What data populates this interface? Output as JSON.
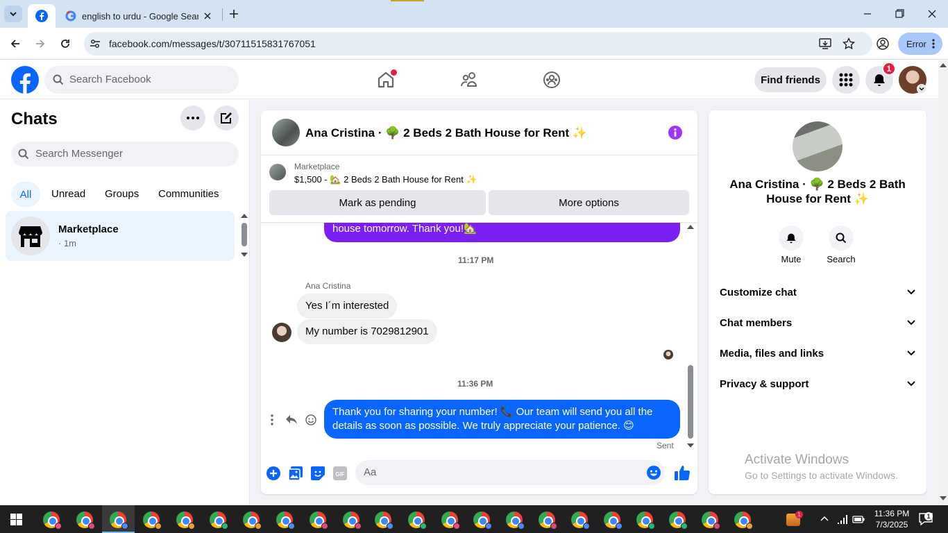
{
  "browser": {
    "tabs": [
      {
        "label": "",
        "icon": "facebook-icon"
      },
      {
        "label": "english to urdu - Google Search",
        "icon": "google-icon"
      }
    ],
    "url": "facebook.com/messages/t/30711515831767051",
    "profile_button": "Error"
  },
  "fb_header": {
    "search_placeholder": "Search Facebook",
    "find_friends": "Find friends",
    "notification_count": "1"
  },
  "left_panel": {
    "title": "Chats",
    "search_placeholder": "Search Messenger",
    "filters": [
      "All",
      "Unread",
      "Groups",
      "Communities"
    ],
    "chat": {
      "name": "Marketplace",
      "meta": "· 1m"
    }
  },
  "conversation": {
    "title": "Ana Cristina · 🌳 2 Beds 2 Bath House for Rent ✨",
    "listing_label": "Marketplace",
    "listing_text": "$1,500 - 🏡 2 Beds 2 Bath House for Rent ✨",
    "mark_pending": "Mark as pending",
    "more_options": "More options",
    "partial_msg": "house tomorrow. Thank you!🏡",
    "time1": "11:17 PM",
    "sender": "Ana Cristina",
    "msg1": "Yes I´m interested",
    "msg2": "My number is 7029812901",
    "time2": "11:36 PM",
    "msg3_line1": "Thank you for sharing your number! 📞 Our team will send you all the",
    "msg3_line2": "details as soon as possible. We truly appreciate your patience. 😊",
    "sent": "Sent",
    "composer_placeholder": "Aa"
  },
  "right_panel": {
    "name_line1": "Ana Cristina · 🌳 2 Beds 2 Bath",
    "name_line2": "House for Rent ✨",
    "mute": "Mute",
    "search": "Search",
    "sections": [
      "Customize chat",
      "Chat members",
      "Media, files and links",
      "Privacy & support"
    ]
  },
  "watermark": {
    "title": "Activate Windows",
    "subtitle": "Go to Settings to activate Windows."
  },
  "taskbar": {
    "time": "11:36 PM",
    "date": "7/3/2025",
    "notification_count": "1"
  },
  "colors": {
    "fb_blue": "#0866ff",
    "purple_bubble": "#7b1ff3",
    "info_purple": "#a033ff"
  }
}
